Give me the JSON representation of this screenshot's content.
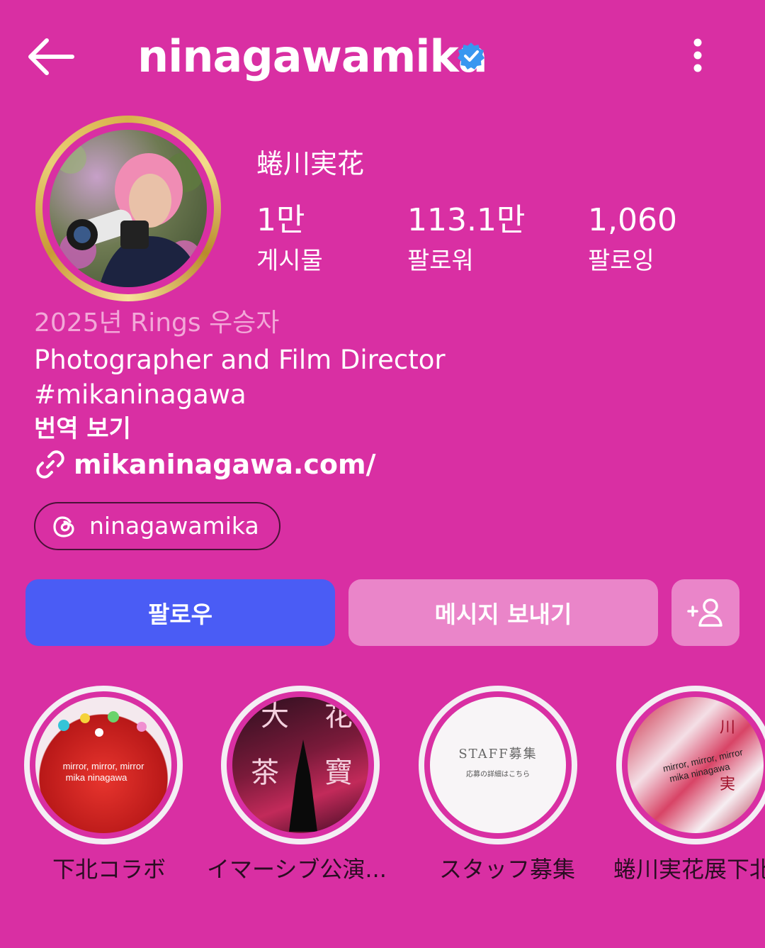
{
  "header": {
    "username": "ninagawamika",
    "verified_icon": "verified-badge-icon",
    "back_icon": "arrow-left-icon",
    "more_icon": "more-vertical-icon"
  },
  "profile": {
    "display_name": "蜷川実花",
    "stats": [
      {
        "value": "1만",
        "label": "게시물"
      },
      {
        "value": "113.1만",
        "label": "팔로워"
      },
      {
        "value": "1,060",
        "label": "팔로잉"
      }
    ]
  },
  "bio": {
    "award": "2025년 Rings 우승자",
    "line1": "Photographer and Film Director",
    "line2": "#mikaninagawa",
    "translate": "번역 보기",
    "link": "mikaninagawa.com/"
  },
  "threads": {
    "handle": "ninagawamika"
  },
  "actions": {
    "follow": "팔로우",
    "message": "메시지 보내기",
    "add_user_icon": "add-user-icon"
  },
  "highlights": [
    {
      "label": "下北コラボ",
      "image_text": "mirror, mirror, mirror\nmika ninagawa"
    },
    {
      "label": "イマーシブ公演...",
      "image_text": "大 花 茶 寶"
    },
    {
      "label": "スタッフ募集",
      "image_text": "STAFF募集",
      "image_subtext": "応募の詳細はこちら"
    },
    {
      "label": "蜷川実花展下北",
      "image_text": "mirror, mirror, mirror\nmika ninagawa"
    }
  ],
  "colors": {
    "background": "#d92fa3",
    "follow_button": "#4a5cf5",
    "secondary_button": "#ea85c9",
    "verified": "#3897f0"
  }
}
